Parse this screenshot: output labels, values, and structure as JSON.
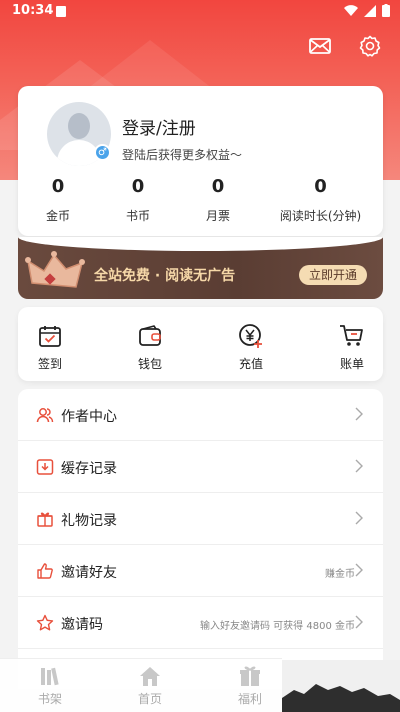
{
  "status_bar": {
    "time": "10:34"
  },
  "header": {
    "mail_icon": "mail-icon",
    "settings_icon": "gear-icon"
  },
  "profile": {
    "login_title": "登录/注册",
    "login_subtitle": "登陆后获得更多权益～",
    "gender_icon": "male-icon",
    "gender_symbol": "♂",
    "stats": [
      {
        "value": "0",
        "label": "金币"
      },
      {
        "value": "0",
        "label": "书币"
      },
      {
        "value": "0",
        "label": "月票"
      },
      {
        "value": "0",
        "label": "阅读时长(分钟)"
      }
    ]
  },
  "vip_banner": {
    "text": "全站免费 · 阅读无广告",
    "button": "立即开通"
  },
  "quick_actions": [
    {
      "label": "签到",
      "icon": "calendar-check-icon"
    },
    {
      "label": "钱包",
      "icon": "wallet-icon"
    },
    {
      "label": "充值",
      "icon": "yuan-plus-icon"
    },
    {
      "label": "账单",
      "icon": "cart-icon"
    }
  ],
  "menu": [
    {
      "label": "作者中心",
      "extra": "",
      "icon": "users-icon"
    },
    {
      "label": "缓存记录",
      "extra": "",
      "icon": "download-icon"
    },
    {
      "label": "礼物记录",
      "extra": "",
      "icon": "gift-icon"
    },
    {
      "label": "邀请好友",
      "extra": "赚金币",
      "icon": "thumbs-up-icon"
    },
    {
      "label": "邀请码",
      "extra": "输入好友邀请码 可获得 4800 金币",
      "icon": "star-icon"
    }
  ],
  "tabs": [
    {
      "label": "书架",
      "icon": "bookshelf-icon"
    },
    {
      "label": "首页",
      "icon": "home-icon"
    },
    {
      "label": "福利",
      "icon": "gift-icon"
    }
  ],
  "colors": {
    "accent": "#f2463f",
    "icon_accent": "#e8503c",
    "banner_bg": "#5a3d33",
    "banner_text": "#f6d8a8"
  }
}
